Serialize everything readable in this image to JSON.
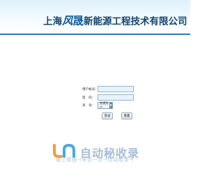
{
  "header": {
    "company_name": {
      "pre": "上海",
      "b1": "风",
      "b2": "晟",
      "post": "新能源工程技术有限公司"
    }
  },
  "login_form": {
    "username_label": "用户帐号：",
    "username_value": "",
    "password_label": "密　码：",
    "password_value": "",
    "role_label": "身　份：",
    "role_selected": "普通用户",
    "login_button": "登录",
    "reset_button": "重置"
  },
  "watermark": {
    "logo_text": "自动秘收录",
    "slogan": "做上链接→来访一次→自动收录→"
  },
  "colors": {
    "header_gradient_top": "#dff0fb",
    "company_text": "#14456e",
    "divider": "#2d7db5",
    "logo_orange": "#f39a3a",
    "logo_blue": "#4aa8e0"
  }
}
